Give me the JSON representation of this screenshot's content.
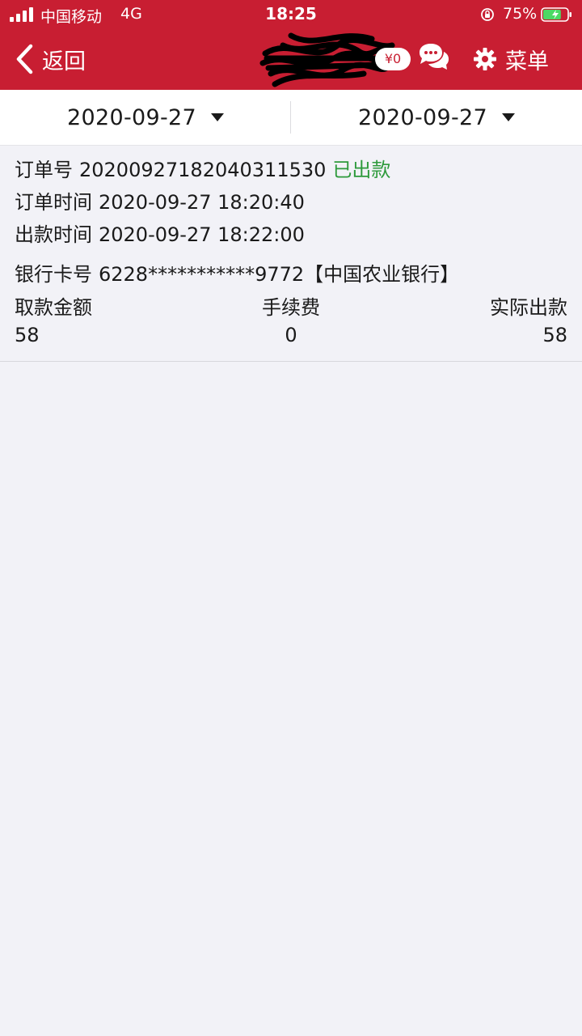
{
  "status_bar": {
    "carrier": "中国移动",
    "network": "4G",
    "time": "18:25",
    "battery_percent": "75%",
    "battery_level": 0.75
  },
  "nav": {
    "back_label": "返回",
    "balance_badge": "¥0",
    "menu_label": "菜单",
    "icons": [
      "back-chevron-icon",
      "chat-bubbles-icon",
      "gear-icon"
    ]
  },
  "date_filter": {
    "start_date": "2020-09-27",
    "end_date": "2020-09-27"
  },
  "order": {
    "order_no_label": "订单号",
    "order_no": "20200927182040311530",
    "status": "已出款",
    "order_time_label": "订单时间",
    "order_time": "2020-09-27 18:20:40",
    "payout_time_label": "出款时间",
    "payout_time": "2020-09-27 18:22:00",
    "bank_card_label": "银行卡号",
    "bank_card": "6228***********9772【中国农业银行】",
    "columns": [
      "取款金额",
      "手续费",
      "实际出款"
    ],
    "values": [
      "58",
      "0",
      "58"
    ]
  },
  "colors": {
    "header_red": "#c81e32",
    "status_green": "#2e9a3c",
    "background": "#f2f2f7"
  }
}
